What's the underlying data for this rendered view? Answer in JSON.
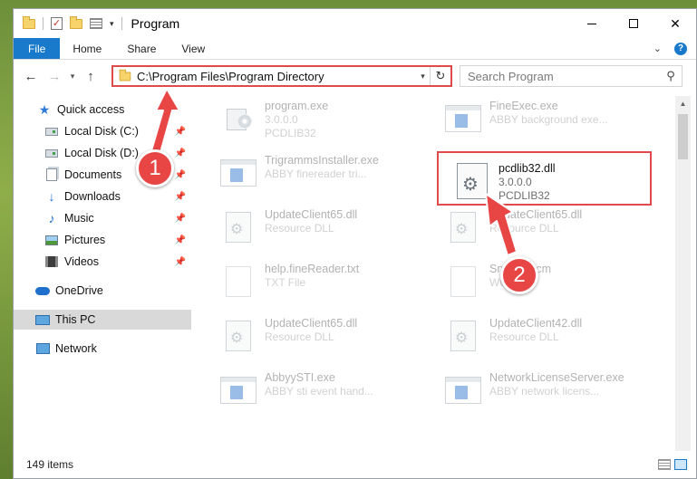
{
  "window": {
    "title": "Program",
    "controls": {
      "minimize": "",
      "maximize": "",
      "close": "✕"
    }
  },
  "ribbon": {
    "tabs": [
      {
        "label": "File"
      },
      {
        "label": "Home"
      },
      {
        "label": "Share"
      },
      {
        "label": "View"
      }
    ],
    "help": "?"
  },
  "navbar": {
    "address": "C:\\Program Files\\Program Directory",
    "search_placeholder": "Search Program"
  },
  "sidebar": {
    "items": [
      {
        "label": "Quick access",
        "icon": "star-icon",
        "pinned": false,
        "selected": false
      },
      {
        "label": "Local Disk (C:)",
        "icon": "disk-icon",
        "pinned": true,
        "selected": false
      },
      {
        "label": "Local Disk (D:)",
        "icon": "disk-icon",
        "pinned": true,
        "selected": false
      },
      {
        "label": "Documents",
        "icon": "documents-icon",
        "pinned": true,
        "selected": false
      },
      {
        "label": "Downloads",
        "icon": "download-icon",
        "pinned": true,
        "selected": false
      },
      {
        "label": "Music",
        "icon": "music-icon",
        "pinned": true,
        "selected": false
      },
      {
        "label": "Pictures",
        "icon": "pictures-icon",
        "pinned": true,
        "selected": false
      },
      {
        "label": "Videos",
        "icon": "videos-icon",
        "pinned": true,
        "selected": false
      },
      {
        "label": "OneDrive",
        "icon": "cloud-icon",
        "pinned": false,
        "selected": false
      },
      {
        "label": "This PC",
        "icon": "computer-icon",
        "pinned": false,
        "selected": true
      },
      {
        "label": "Network",
        "icon": "network-icon",
        "pinned": false,
        "selected": false
      }
    ]
  },
  "files": [
    {
      "name": "program.exe",
      "line1": "3.0.0.0",
      "line2": "PCDLIB32",
      "icon": "setup-icon"
    },
    {
      "name": "FineExec.exe",
      "line1": "ABBY background exe...",
      "line2": "",
      "icon": "exe-icon"
    },
    {
      "name": "TrigrammsInstaller.exe",
      "line1": "ABBY finereader tri...",
      "line2": "",
      "icon": "exe-icon"
    },
    {
      "name": "pcdlib32.dll",
      "line1": "3.0.0.0",
      "line2": "PCDLIB32",
      "icon": "dll-gear-icon"
    },
    {
      "name": "UpdateClient65.dll",
      "line1": "Resource DLL",
      "line2": "",
      "icon": "dll-icon"
    },
    {
      "name": "UpdateClient65.dll",
      "line1": "Resource DLL",
      "line2": "",
      "icon": "dll-icon"
    },
    {
      "name": "help.fineReader.txt",
      "line1": "TXT File",
      "line2": "",
      "icon": "text-file-icon"
    },
    {
      "name": "Snc...5.wcm",
      "line1": "WCM...",
      "line2": "",
      "icon": "text-file-icon"
    },
    {
      "name": "UpdateClient65.dll",
      "line1": "Resource DLL",
      "line2": "",
      "icon": "dll-icon"
    },
    {
      "name": "UpdateClient42.dll",
      "line1": "Resource DLL",
      "line2": "",
      "icon": "dll-icon"
    },
    {
      "name": "AbbyySTI.exe",
      "line1": "ABBY sti event hand...",
      "line2": "",
      "icon": "exe-icon"
    },
    {
      "name": "NetworkLicenseServer.exe",
      "line1": "ABBY network licens...",
      "line2": "",
      "icon": "exe-icon"
    }
  ],
  "status": {
    "item_count": "149 items"
  },
  "annotations": [
    {
      "label": "1"
    },
    {
      "label": "2"
    }
  ],
  "colors": {
    "accent": "#1979ca",
    "annotation": "#e04a4a"
  }
}
